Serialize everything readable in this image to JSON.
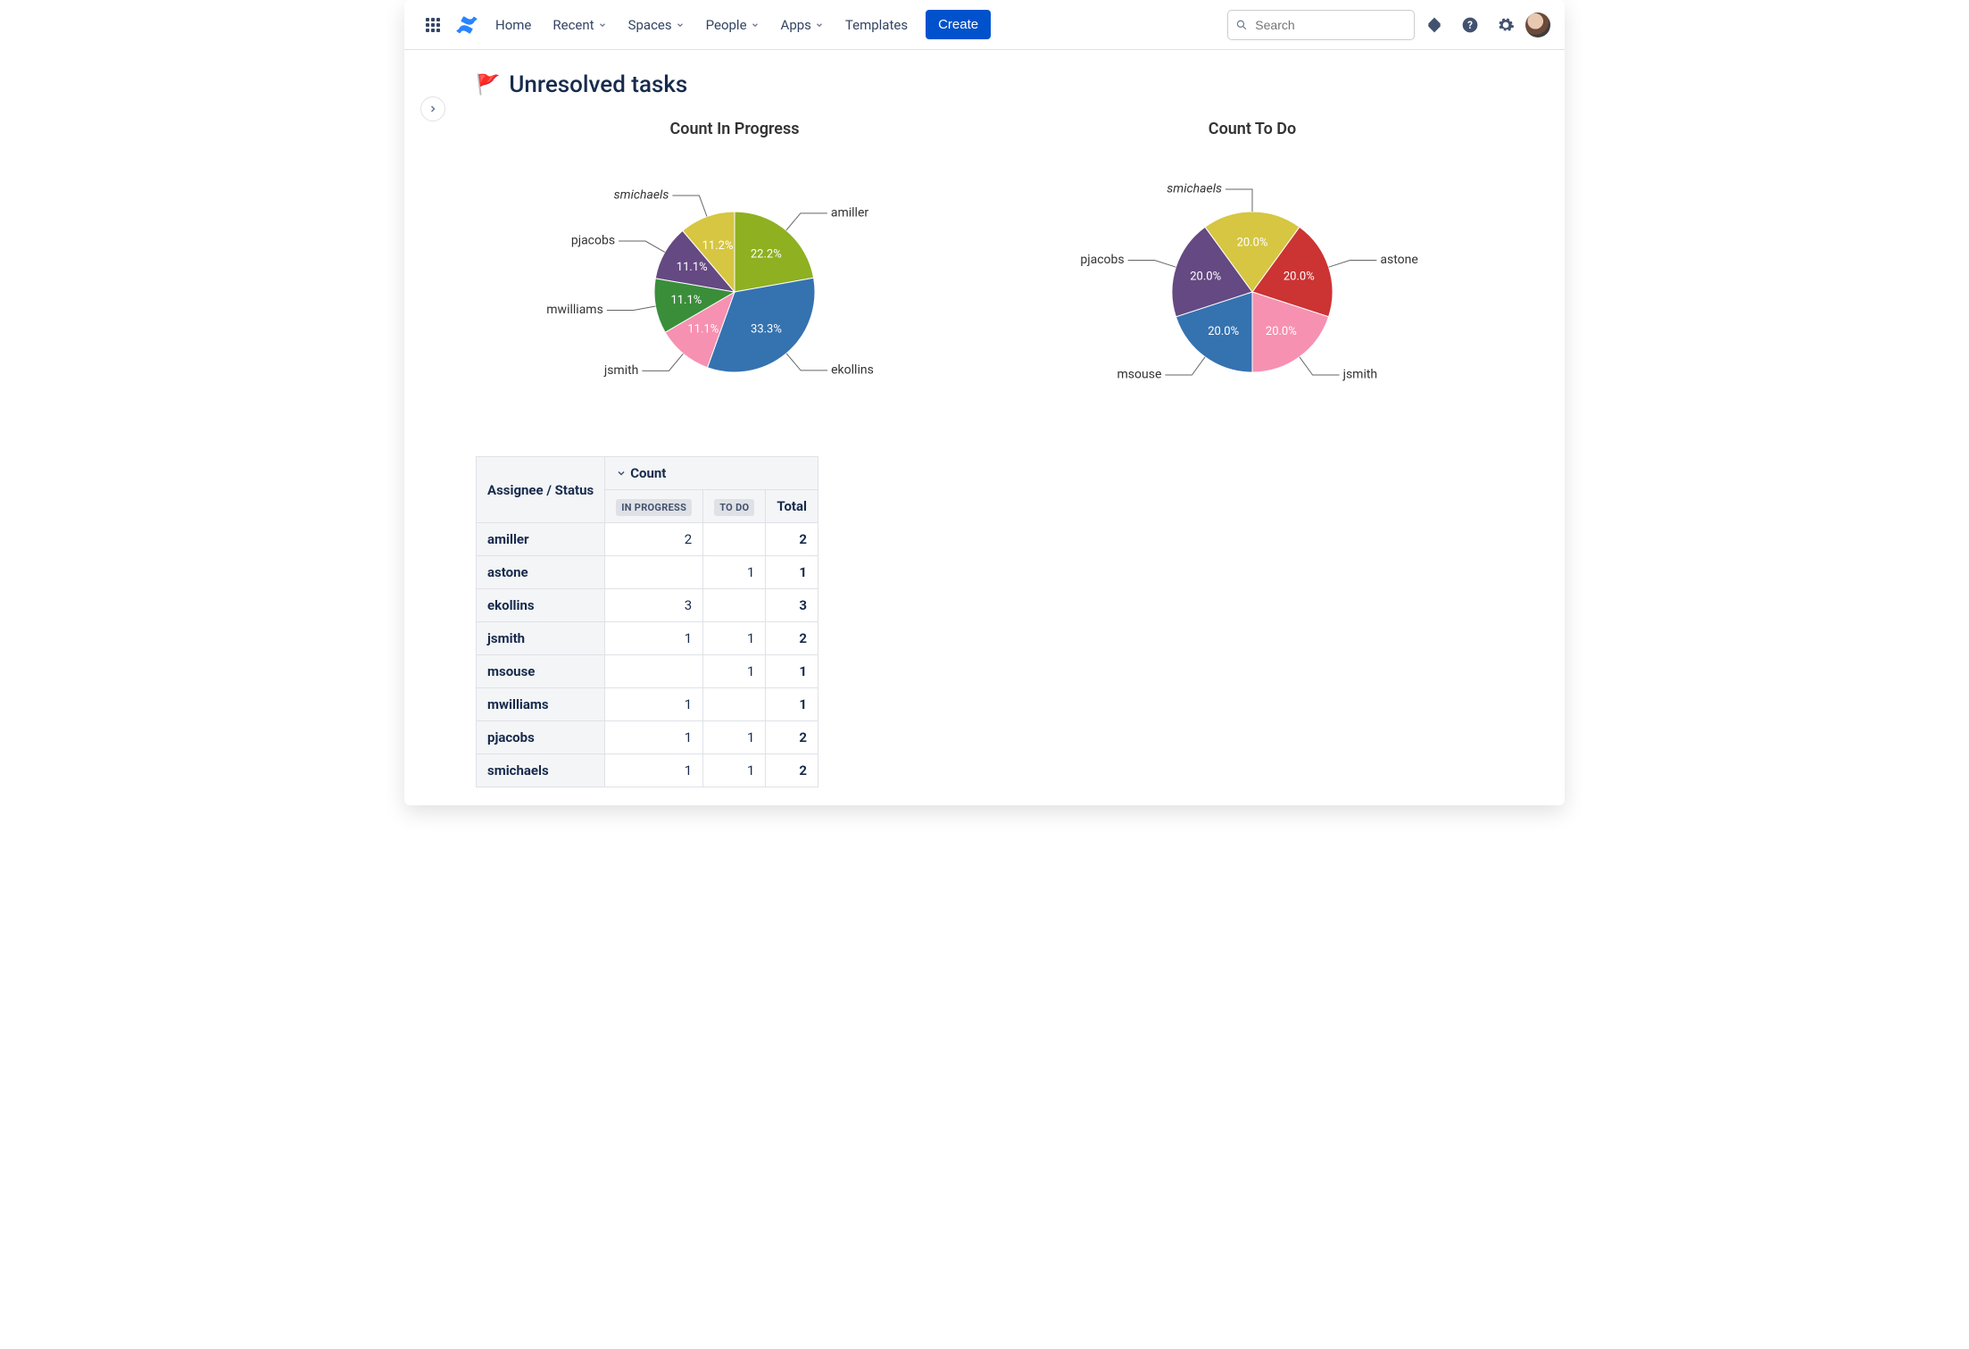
{
  "header": {
    "nav": {
      "home": "Home",
      "recent": "Recent",
      "spaces": "Spaces",
      "people": "People",
      "apps": "Apps",
      "templates": "Templates",
      "create": "Create"
    },
    "search_placeholder": "Search"
  },
  "page": {
    "title": "Unresolved tasks"
  },
  "chart_data": [
    {
      "type": "pie",
      "title": "Count In Progress",
      "series": [
        {
          "name": "amiller",
          "value": 22.2,
          "label": "22.2%",
          "color": "#8EB021",
          "italic": false
        },
        {
          "name": "ekollins",
          "value": 33.3,
          "label": "33.3%",
          "color": "#3572B0",
          "italic": false
        },
        {
          "name": "jsmith",
          "value": 11.1,
          "label": "11.1%",
          "color": "#F691B2",
          "italic": false
        },
        {
          "name": "mwilliams",
          "value": 11.1,
          "label": "11.1%",
          "color": "#3A8E3A",
          "italic": false
        },
        {
          "name": "pjacobs",
          "value": 11.1,
          "label": "11.1%",
          "color": "#654982",
          "italic": false
        },
        {
          "name": "smichaels",
          "value": 11.2,
          "label": "11.2%",
          "color": "#D6C642",
          "italic": true
        }
      ]
    },
    {
      "type": "pie",
      "title": "Count To Do",
      "series": [
        {
          "name": "astone",
          "value": 20.0,
          "label": "20.0%",
          "color": "#CC3333",
          "italic": false
        },
        {
          "name": "jsmith",
          "value": 20.0,
          "label": "20.0%",
          "color": "#F691B2",
          "italic": false
        },
        {
          "name": "msouse",
          "value": 20.0,
          "label": "20.0%",
          "color": "#3572B0",
          "italic": false
        },
        {
          "name": "pjacobs",
          "value": 20.0,
          "label": "20.0%",
          "color": "#654982",
          "italic": false
        },
        {
          "name": "smichaels",
          "value": 20.0,
          "label": "20.0%",
          "color": "#D6C642",
          "italic": true
        }
      ]
    }
  ],
  "table": {
    "col_assignee": "Assignee / Status",
    "col_count": "Count",
    "status1": "IN PROGRESS",
    "status2": "TO DO",
    "col_total": "Total",
    "rows": [
      {
        "assignee": "amiller",
        "in_progress": "2",
        "to_do": "",
        "total": "2"
      },
      {
        "assignee": "astone",
        "in_progress": "",
        "to_do": "1",
        "total": "1"
      },
      {
        "assignee": "ekollins",
        "in_progress": "3",
        "to_do": "",
        "total": "3"
      },
      {
        "assignee": "jsmith",
        "in_progress": "1",
        "to_do": "1",
        "total": "2"
      },
      {
        "assignee": "msouse",
        "in_progress": "",
        "to_do": "1",
        "total": "1"
      },
      {
        "assignee": "mwilliams",
        "in_progress": "1",
        "to_do": "",
        "total": "1"
      },
      {
        "assignee": "pjacobs",
        "in_progress": "1",
        "to_do": "1",
        "total": "2"
      },
      {
        "assignee": "smichaels",
        "in_progress": "1",
        "to_do": "1",
        "total": "2"
      }
    ]
  }
}
